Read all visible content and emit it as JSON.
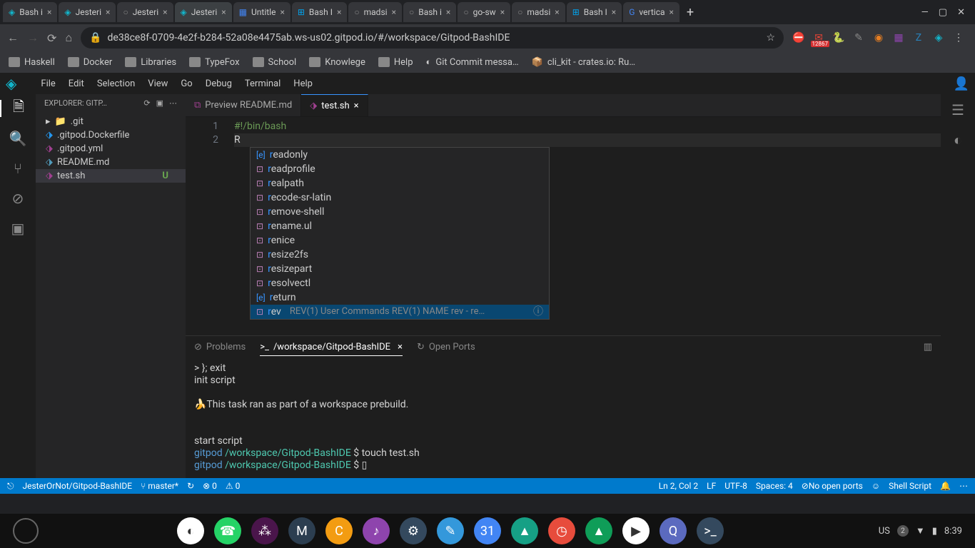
{
  "browser": {
    "tabs": [
      {
        "title": "Bash i",
        "icon": "◈",
        "color": "#12b5cb"
      },
      {
        "title": "Jesteri",
        "icon": "◈",
        "color": "#12b5cb"
      },
      {
        "title": "Jesteri",
        "icon": "○",
        "color": "#888"
      },
      {
        "title": "Jesteri",
        "icon": "◈",
        "color": "#12b5cb",
        "active": true
      },
      {
        "title": "Untitle",
        "icon": "▦",
        "color": "#4285f4"
      },
      {
        "title": "Bash I",
        "icon": "⊞",
        "color": "#00a4ef"
      },
      {
        "title": "madsi",
        "icon": "○",
        "color": "#888"
      },
      {
        "title": "Bash i",
        "icon": "○",
        "color": "#888"
      },
      {
        "title": "go-sw",
        "icon": "○",
        "color": "#888"
      },
      {
        "title": "madsi",
        "icon": "○",
        "color": "#888"
      },
      {
        "title": "Bash I",
        "icon": "⊞",
        "color": "#00a4ef"
      },
      {
        "title": "vertica",
        "icon": "G",
        "color": "#4285f4"
      }
    ],
    "url": "de38ce8f-0709-4e2f-b284-52a08e4475ab.ws-us02.gitpod.io/#/workspace/Gitpod-BashIDE",
    "star": "☆",
    "ext": [
      {
        "n": "adblock",
        "c": "#d63031",
        "g": "⛔"
      },
      {
        "n": "gmail",
        "c": "#ea4335",
        "g": "✉",
        "badge": "12867"
      },
      {
        "n": "python",
        "c": "#3776ab",
        "g": "🐍"
      },
      {
        "n": "pen",
        "c": "#888",
        "g": "✎"
      },
      {
        "n": "circle",
        "c": "#e67e22",
        "g": "◉"
      },
      {
        "n": "box",
        "c": "#8e44ad",
        "g": "▦"
      },
      {
        "n": "z",
        "c": "#2980b9",
        "g": "Z"
      },
      {
        "n": "gitpod",
        "c": "#12b5cb",
        "g": "◈"
      },
      {
        "n": "menu",
        "c": "#ccc",
        "g": "⋮"
      }
    ],
    "bookmarks": [
      {
        "l": "Haskell"
      },
      {
        "l": "Docker"
      },
      {
        "l": "Libraries"
      },
      {
        "l": "TypeFox"
      },
      {
        "l": "School"
      },
      {
        "l": "Knowlege"
      },
      {
        "l": "Help"
      }
    ],
    "bk_extra": [
      {
        "l": "Git Commit messa…",
        "icon": "github"
      },
      {
        "l": "cli_kit - crates.io: Ru…",
        "icon": "crate"
      }
    ]
  },
  "ide": {
    "menu": [
      "File",
      "Edit",
      "Selection",
      "View",
      "Go",
      "Debug",
      "Terminal",
      "Help"
    ],
    "explorer_title": "EXPLORER: GITP…",
    "files": [
      {
        "name": ".git",
        "type": "folder",
        "chev": "▸"
      },
      {
        "name": ".gitpod.Dockerfile",
        "type": "docker",
        "color": "#2496ed"
      },
      {
        "name": ".gitpod.yml",
        "type": "yml",
        "color": "#a04090"
      },
      {
        "name": "README.md",
        "type": "md",
        "color": "#519aba"
      },
      {
        "name": "test.sh",
        "type": "sh",
        "color": "#a04090",
        "status": "U",
        "active": true
      }
    ],
    "tabs": [
      {
        "label": "Preview README.md",
        "icon": "⧉",
        "active": false
      },
      {
        "label": "test.sh",
        "icon": "⬗",
        "active": true,
        "close": "×"
      }
    ],
    "code": {
      "line1": "#!/bin/bash",
      "line2": "R"
    },
    "suggest": [
      {
        "p": "r",
        "r": "eadonly",
        "ico": "[e]"
      },
      {
        "p": "r",
        "r": "eadprofile",
        "ico": "⊡"
      },
      {
        "p": "r",
        "r": "ealpath",
        "ico": "⊡"
      },
      {
        "p": "r",
        "r": "ecode-sr-latin",
        "ico": "⊡"
      },
      {
        "p": "r",
        "r": "emove-shell",
        "ico": "⊡"
      },
      {
        "p": "r",
        "r": "ename.ul",
        "ico": "⊡"
      },
      {
        "p": "r",
        "r": "enice",
        "ico": "⊡"
      },
      {
        "p": "r",
        "r": "esize2fs",
        "ico": "⊡"
      },
      {
        "p": "r",
        "r": "esizepart",
        "ico": "⊡"
      },
      {
        "p": "r",
        "r": "esolvectl",
        "ico": "⊡"
      },
      {
        "p": "r",
        "r": "eturn",
        "ico": "[e]"
      },
      {
        "p": "r",
        "r": "ev",
        "ico": "⊡",
        "sel": true,
        "detail": "REV(1) User Commands REV(1) NAME rev - re…",
        "info": "ⓘ"
      }
    ],
    "panel_tabs": [
      {
        "l": "Problems",
        "icon": "⊘"
      },
      {
        "l": "/workspace/Gitpod-BashIDE",
        "icon": ">_",
        "active": true,
        "close": "×"
      },
      {
        "l": "Open Ports",
        "icon": "↻"
      }
    ],
    "term": {
      "l1": "> }; exit",
      "l2": "init script",
      "l3": "🍌This task ran as part of a workspace prebuild.",
      "l4": "start script",
      "prompt_user": "gitpod ",
      "prompt_path": "/workspace/Gitpod-BashIDE",
      "prompt_sep": " $ ",
      "cmd1": "touch test.sh",
      "cursor": "▯"
    },
    "status": {
      "repo": "JesterOrNot/Gitpod-BashIDE",
      "branch": "master*",
      "sync": "↻",
      "err": "⊗ 0",
      "warn": "⚠ 0",
      "pos": "Ln 2, Col 2",
      "eol": "LF",
      "enc": "UTF-8",
      "spaces": "Spaces: 4",
      "ports": "⊘No open ports",
      "lang": "Shell Script",
      "feedback": "☺",
      "bell": "🔔"
    }
  },
  "shelf": {
    "apps": [
      {
        "n": "chrome",
        "c": "#fff",
        "g": "◐"
      },
      {
        "n": "whatsapp",
        "c": "#25d366",
        "g": "☎"
      },
      {
        "n": "slack",
        "c": "#4a154b",
        "g": "⁂"
      },
      {
        "n": "m",
        "c": "#2c3e50",
        "g": "M"
      },
      {
        "n": "c",
        "c": "#f39c12",
        "g": "C"
      },
      {
        "n": "music",
        "c": "#8e44ad",
        "g": "♪"
      },
      {
        "n": "settings",
        "c": "#34495e",
        "g": "⚙"
      },
      {
        "n": "draw",
        "c": "#3498db",
        "g": "✎"
      },
      {
        "n": "cal",
        "c": "#4285f4",
        "g": "31"
      },
      {
        "n": "campus",
        "c": "#16a085",
        "g": "▲"
      },
      {
        "n": "clock",
        "c": "#e74c3c",
        "g": "◷"
      },
      {
        "n": "drive",
        "c": "#0f9d58",
        "g": "▲"
      },
      {
        "n": "play",
        "c": "#fff",
        "g": "▶"
      },
      {
        "n": "q",
        "c": "#5b6abf",
        "g": "Q"
      },
      {
        "n": "term",
        "c": "#34495e",
        "g": ">_"
      }
    ],
    "tray": {
      "lang": "US",
      "badge": "2",
      "wifi": "▼",
      "batt": "▮",
      "time": "8:39"
    }
  }
}
